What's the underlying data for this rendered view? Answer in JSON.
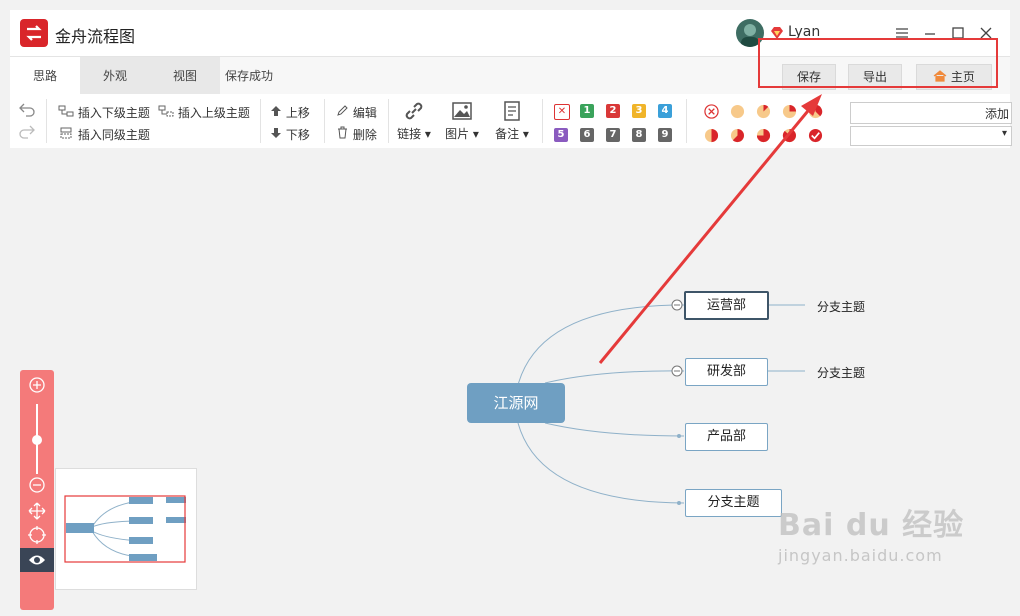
{
  "app": {
    "title": "金舟流程图",
    "user": "Lyan"
  },
  "menubar": {
    "tabs": [
      "思路",
      "外观",
      "视图"
    ],
    "status": "保存成功",
    "buttons": {
      "save": "保存",
      "export": "导出",
      "home": "主页"
    }
  },
  "toolbar": {
    "insert_child": "插入下级主题",
    "insert_parent": "插入上级主题",
    "insert_sibling": "插入同级主题",
    "move_up": "上移",
    "move_down": "下移",
    "edit": "编辑",
    "delete": "删除",
    "link": "链接",
    "image": "图片",
    "note": "备注",
    "priority_badges": [
      "1",
      "2",
      "3",
      "4",
      "5",
      "6",
      "7",
      "8",
      "9"
    ],
    "side_label": "添加"
  },
  "mindmap": {
    "root": "江源网",
    "branches": [
      "运营部",
      "研发部",
      "产品部",
      "分支主题"
    ],
    "sub_topics": [
      "分支主题",
      "分支主题"
    ]
  },
  "watermark": {
    "brand": "Bai du 经验",
    "url": "jingyan.baidu.com"
  },
  "colors": {
    "accent_red": "#d9252a",
    "node_border": "#7aa5c4",
    "root_fill": "#6f9fc2",
    "zoom_bar": "#f47a7a",
    "highlight": "#e53a3a"
  }
}
